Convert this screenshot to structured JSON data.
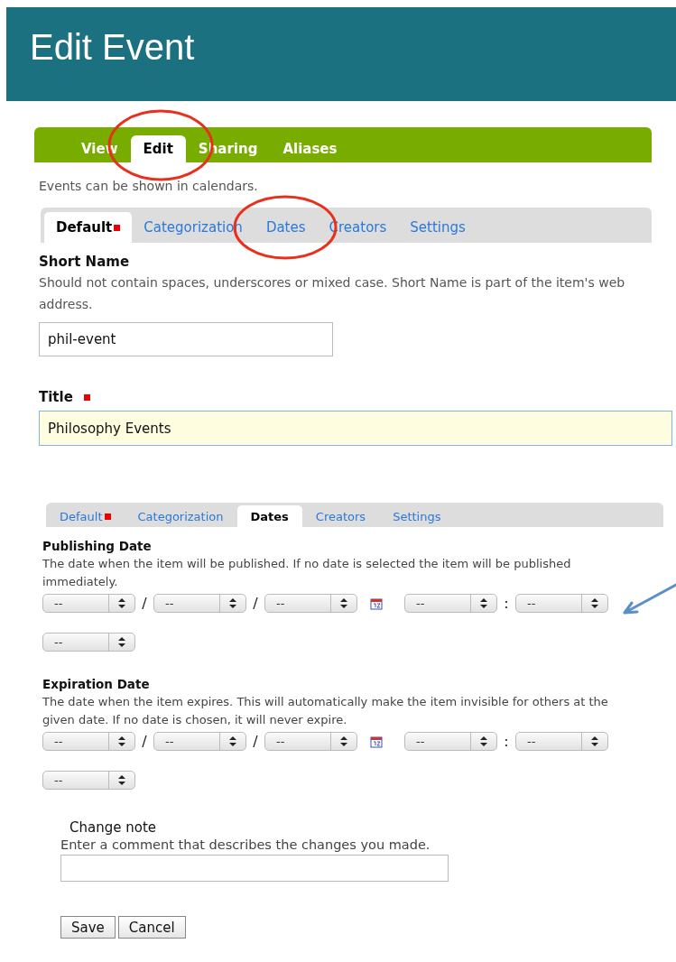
{
  "header": {
    "title": "Edit Event"
  },
  "main_tabs": [
    {
      "label": "View",
      "selected": false
    },
    {
      "label": "Edit",
      "selected": true
    },
    {
      "label": "Sharing",
      "selected": false
    },
    {
      "label": "Aliases",
      "selected": false
    }
  ],
  "intro": "Events can be shown in calendars.",
  "default_panel": {
    "tabs": [
      {
        "label": "Default",
        "selected": true,
        "required": true
      },
      {
        "label": "Categorization",
        "selected": false,
        "required": false
      },
      {
        "label": "Dates",
        "selected": false,
        "required": false
      },
      {
        "label": "Creators",
        "selected": false,
        "required": false
      },
      {
        "label": "Settings",
        "selected": false,
        "required": false
      }
    ],
    "fields": [
      {
        "label": "Short Name",
        "description": "Should not contain spaces, underscores or mixed case. Short Name is part of the item's web address.",
        "value": "phil-event",
        "focused": false
      },
      {
        "label": "Title",
        "required": true,
        "value": "Philosophy Events",
        "focused": true
      }
    ]
  },
  "dates_panel": {
    "tabs": [
      {
        "label": "Default",
        "selected": false,
        "required": true
      },
      {
        "label": "Categorization",
        "selected": false,
        "required": false
      },
      {
        "label": "Dates",
        "selected": true,
        "required": false
      },
      {
        "label": "Creators",
        "selected": false,
        "required": false
      },
      {
        "label": "Settings",
        "selected": false,
        "required": false
      }
    ],
    "sections": [
      {
        "label": "Publishing Date",
        "description": "The date when the item will be published. If no date is selected the item will be published immediately.",
        "controls": [
          {
            "kind": "select",
            "value": "--"
          },
          {
            "kind": "separator",
            "text": "/"
          },
          {
            "kind": "select",
            "value": "--"
          },
          {
            "kind": "separator",
            "text": "/"
          },
          {
            "kind": "select",
            "value": "--"
          },
          {
            "kind": "calendar"
          },
          {
            "kind": "select",
            "value": "--"
          },
          {
            "kind": "separator",
            "text": ":"
          },
          {
            "kind": "select",
            "value": "--"
          },
          {
            "kind": "break"
          },
          {
            "kind": "select",
            "value": "--"
          }
        ]
      },
      {
        "label": "Expiration Date",
        "description": "The date when the item expires. This will automatically make the item invisible for others at the given date. If no date is chosen, it will never expire.",
        "controls": [
          {
            "kind": "select",
            "value": "--"
          },
          {
            "kind": "separator",
            "text": "/"
          },
          {
            "kind": "select",
            "value": "--"
          },
          {
            "kind": "separator",
            "text": "/"
          },
          {
            "kind": "select",
            "value": "--"
          },
          {
            "kind": "calendar"
          },
          {
            "kind": "select",
            "value": "--"
          },
          {
            "kind": "separator",
            "text": ":"
          },
          {
            "kind": "select",
            "value": "--"
          },
          {
            "kind": "break"
          },
          {
            "kind": "select",
            "value": "--"
          }
        ]
      }
    ]
  },
  "change_note": {
    "label": "Change note",
    "description": "Enter a comment that describes the changes you made."
  },
  "buttons": [
    "Save",
    "Cancel"
  ]
}
